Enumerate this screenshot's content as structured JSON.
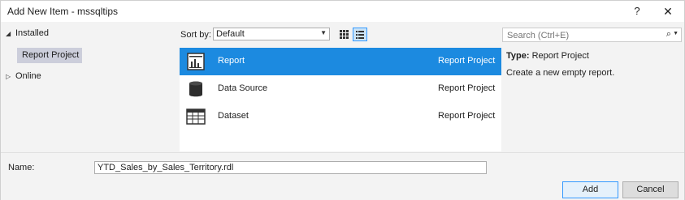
{
  "window": {
    "title": "Add New Item - mssqltips",
    "help_icon": "?",
    "close_icon": "✕"
  },
  "tree": {
    "installed": {
      "label": "Installed",
      "icon": "triangle-down"
    },
    "installed_child": "Report Project",
    "online": {
      "label": "Online",
      "icon": "triangle-right"
    }
  },
  "sort": {
    "label": "Sort by:",
    "value": "Default"
  },
  "search": {
    "placeholder": "Search (Ctrl+E)"
  },
  "templates": [
    {
      "name": "Report",
      "type": "Report Project",
      "icon": "report-icon",
      "selected": true
    },
    {
      "name": "Data Source",
      "type": "Report Project",
      "icon": "database-icon",
      "selected": false
    },
    {
      "name": "Dataset",
      "type": "Report Project",
      "icon": "dataset-grid-icon",
      "selected": false
    }
  ],
  "details": {
    "type_label": "Type:",
    "type_value": "Report Project",
    "description": "Create a new empty report."
  },
  "footer": {
    "name_label": "Name:",
    "name_value": "YTD_Sales_by_Sales_Territory.rdl",
    "add_label": "Add",
    "cancel_label": "Cancel"
  },
  "colors": {
    "selection": "#1c8ae0",
    "tree_selection": "#cccedb",
    "dialog_bg": "#f3f3f3"
  }
}
